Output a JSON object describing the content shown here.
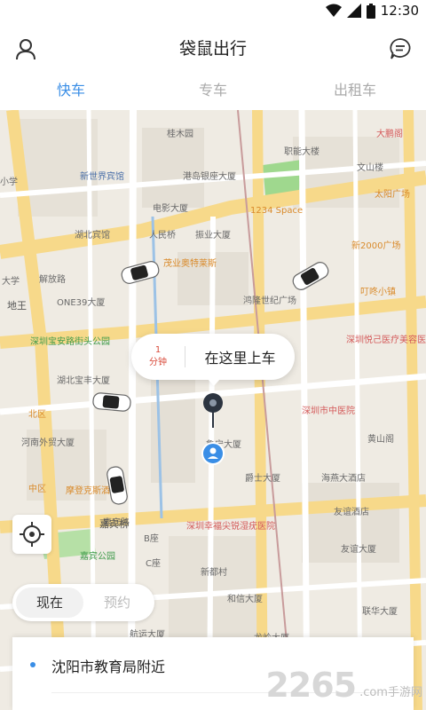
{
  "status_bar": {
    "time": "12:30"
  },
  "header": {
    "title": "袋鼠出行"
  },
  "tabs": [
    {
      "label": "快车",
      "active": true
    },
    {
      "label": "专车",
      "active": false
    },
    {
      "label": "出租车",
      "active": false
    }
  ],
  "map": {
    "labels": [
      "桂木园",
      "职能大楼",
      "大鹏阁",
      "文山楼",
      "新世界宾馆",
      "港岛银座大厦",
      "小学",
      "电影大厦",
      "太阳广场",
      "1234 Space",
      "湖北宾馆",
      "振业大厦",
      "人民桥",
      "新2000广场",
      "茂业奥特莱斯",
      "解放路",
      "ONE39大厦",
      "鸿隆世纪广场",
      "叮咚小镇",
      "大学",
      "地王",
      "深圳宝安路街头公园",
      "深圳悦己医疗美容医院",
      "湖北宝丰大厦",
      "嘉宾路",
      "深圳市中医院",
      "北区",
      "河南外贸大厦",
      "鲁宁大厦",
      "黄山阁",
      "爵士大厦",
      "中区",
      "海燕大酒店",
      "摩登克斯酒店",
      "深圳幸福尖锐湿疣医院",
      "嘉宾桥",
      "B座",
      "友谊酒店",
      "嘉宾公园",
      "友谊大厦",
      "C座",
      "新都村",
      "和信大厦",
      "航运大厦",
      "联华大厦",
      "龙岭大厦"
    ]
  },
  "pickup_bubble": {
    "eta_value": "1",
    "eta_unit": "分钟",
    "text": "在这里上车"
  },
  "mode_toggle": {
    "now": "现在",
    "reserve": "预约"
  },
  "destination": {
    "text": "沈阳市教育局附近"
  },
  "watermark": {
    "brand": "2265",
    "suffix": ".com",
    "site": "手游网"
  },
  "colors": {
    "accent": "#3a8ee6",
    "map_bg": "#efebe3",
    "road": "#ffffff",
    "major_road": "#f7d98a",
    "park": "#9fd88e",
    "eta": "#d94a3a"
  }
}
